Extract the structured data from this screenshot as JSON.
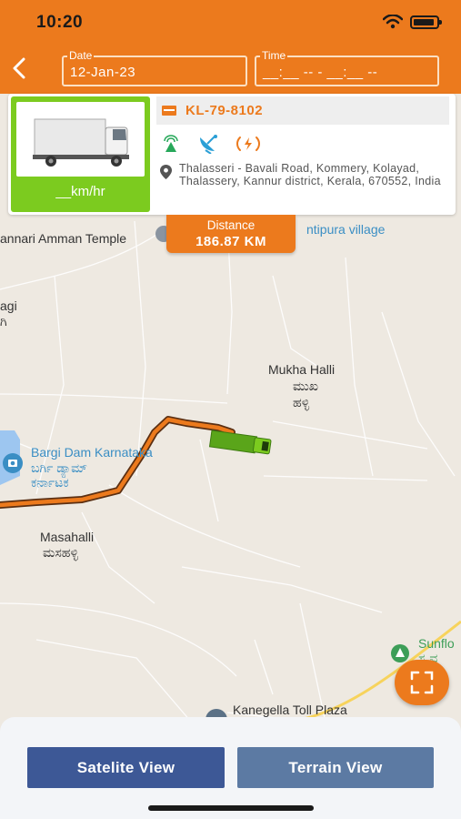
{
  "status_bar": {
    "time": "10:20"
  },
  "header": {
    "date_label": "Date",
    "date_value": "12-Jan-23",
    "time_label": "Time",
    "time_value": "__:__ -- - __:__ --"
  },
  "vehicle": {
    "speed": "__km/hr",
    "plate": "KL-79-8102",
    "address": "Thalasseri - Bavali Road, Kommery, Kolayad, Thalassery, Kannur district, Kerala, 670552, India",
    "status_colors": {
      "gps": "#27a85a",
      "satellite": "#2a9fd6",
      "power": "#ec7a1d"
    }
  },
  "distance": {
    "label": "Distance",
    "value": "186.87 KM"
  },
  "map": {
    "labels": {
      "temple": "annari Amman Temple",
      "village": "ntipura village",
      "agi": "agi",
      "agi_kn": "ಗಿ",
      "mukha": "Mukha Halli",
      "mukha_kn": "ಮುಖ",
      "mukha_kn2": "ಹಳ್ಳಿ",
      "bargi": "Bargi Dam Karnataka",
      "bargi_kn": "ಬರ್ಗಿ ಡ್ಯಾಮ್",
      "bargi_kn2": "ಕರ್ನಾಟಕ",
      "masahalli": "Masahalli",
      "masahalli_kn": "ಮಸಹಳ್ಳಿ",
      "sunflo": "Sunflo",
      "sunflo_kn": "ಸ್ಟ ವ",
      "toll": "Kanegella Toll Plaza"
    },
    "route_color": "#ec7a1d"
  },
  "bottom": {
    "satelite_label": "Satelite View",
    "terrain_label": "Terrain View"
  }
}
